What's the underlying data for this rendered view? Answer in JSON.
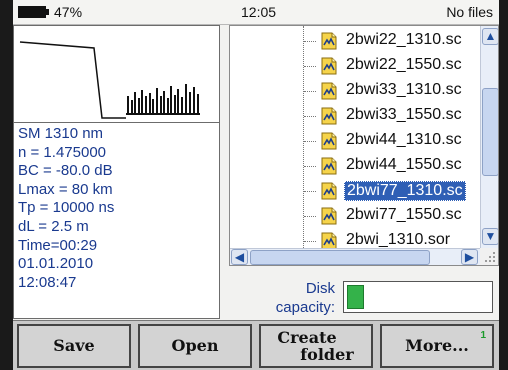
{
  "status": {
    "battery_pct": "47%",
    "time": "12:05",
    "files_label": "No files"
  },
  "info": [
    "SM 1310 nm",
    "n = 1.475000",
    "BC = -80.0 dB",
    "Lmax = 80 km",
    "Tp = 10000 ns",
    "dL = 2.5 m",
    "Time=00:29",
    "01.01.2010",
    "12:08:47"
  ],
  "files": [
    {
      "name": "2bwi22_1310.sc",
      "selected": false
    },
    {
      "name": "2bwi22_1550.sc",
      "selected": false
    },
    {
      "name": "2bwi33_1310.sc",
      "selected": false
    },
    {
      "name": "2bwi33_1550.sc",
      "selected": false
    },
    {
      "name": "2bwi44_1310.sc",
      "selected": false
    },
    {
      "name": "2bwi44_1550.sc",
      "selected": false
    },
    {
      "name": "2bwi77_1310.sc",
      "selected": true
    },
    {
      "name": "2bwi77_1550.sc",
      "selected": false
    },
    {
      "name": "2bwi_1310.sor",
      "selected": false
    }
  ],
  "disk": {
    "label_line1": "Disk",
    "label_line2": "capacity:",
    "used_fraction": 0.12
  },
  "softkeys": {
    "save": "Save",
    "open": "Open",
    "create_line1": "Create",
    "create_line2": "folder",
    "more": "More...",
    "more_badge": "1"
  },
  "icons": {
    "scroll_up": "▲",
    "scroll_down": "▼",
    "scroll_left": "◀",
    "scroll_right": "▶"
  },
  "colors": {
    "info_text": "#1a3a8f",
    "selection": "#2f5fb5",
    "disk_fill": "#34b24a"
  }
}
